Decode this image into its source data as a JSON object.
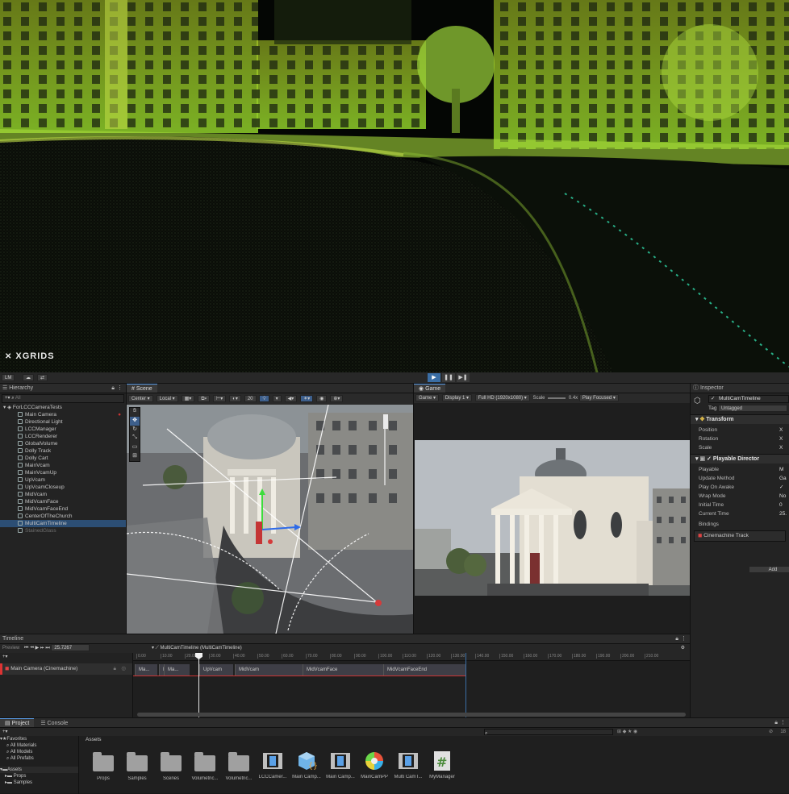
{
  "hero": {
    "brand": "XGRIDS"
  },
  "toolbar": {
    "account": "LM",
    "play_icon": "play-icon",
    "pause_icon": "pause-icon",
    "step_icon": "step-icon"
  },
  "hierarchy": {
    "title": "Hierarchy",
    "search": "All",
    "scene": "ForLCCCameraTests",
    "items": [
      {
        "label": "Main Camera",
        "state": "normal"
      },
      {
        "label": "Directional Light",
        "state": "normal"
      },
      {
        "label": "LCCManager",
        "state": "normal"
      },
      {
        "label": "LCCRenderer",
        "state": "normal"
      },
      {
        "label": "GlobalVolume",
        "state": "normal"
      },
      {
        "label": "Dolly Track",
        "state": "normal"
      },
      {
        "label": "Dolly Cart",
        "state": "normal"
      },
      {
        "label": "MainVcam",
        "state": "normal"
      },
      {
        "label": "MainVcamUp",
        "state": "normal"
      },
      {
        "label": "UpVcam",
        "state": "normal"
      },
      {
        "label": "UpVcamCloseup",
        "state": "normal"
      },
      {
        "label": "MidVcam",
        "state": "normal"
      },
      {
        "label": "MidVcamFace",
        "state": "normal"
      },
      {
        "label": "MidVcamFaceEnd",
        "state": "normal"
      },
      {
        "label": "CenterOfTheChurch",
        "state": "normal"
      },
      {
        "label": "MultiCamTimeline",
        "state": "selected"
      },
      {
        "label": "StainedGlass",
        "state": "dim"
      }
    ]
  },
  "scene": {
    "tab": "Scene",
    "pivot": "Center",
    "space": "Local",
    "grid_value": "20",
    "tools": [
      "hand",
      "move",
      "rotate",
      "scale",
      "rect",
      "transform"
    ]
  },
  "game": {
    "tab": "Game",
    "mode": "Game",
    "display": "Display 1",
    "resolution": "Full HD (1920x1080)",
    "scale_label": "Scale",
    "scale_value": "0.4x",
    "play_focused": "Play Focused"
  },
  "inspector": {
    "title": "Inspector",
    "object_name": "MultiCamTimeline",
    "tag_label": "Tag",
    "tag_value": "Untagged",
    "transform": {
      "header": "Transform",
      "rows": [
        {
          "label": "Position",
          "value": "X"
        },
        {
          "label": "Rotation",
          "value": "X"
        },
        {
          "label": "Scale",
          "value": "X"
        }
      ]
    },
    "director": {
      "header": "Playable Director",
      "rows": [
        {
          "label": "Playable",
          "value": "M"
        },
        {
          "label": "Update Method",
          "value": "Ga"
        },
        {
          "label": "Play On Awake",
          "value": "✓"
        },
        {
          "label": "Wrap Mode",
          "value": "No"
        },
        {
          "label": "Initial Time",
          "value": "0"
        },
        {
          "label": "Current Time",
          "value": "25."
        }
      ],
      "bindings_label": "Bindings",
      "binding_track": "Cinemachine Track"
    },
    "add_button": "Add"
  },
  "timeline": {
    "title": "Timeline",
    "preview": "Preview",
    "time": "25.7267",
    "asset": "MultiCamTimeline (MultiCamTimeline)",
    "ticks": [
      "0.00",
      "10.00",
      "20.00",
      "30.00",
      "40.00",
      "50.00",
      "60.00",
      "70.00",
      "80.00",
      "90.00",
      "100.00",
      "110.00",
      "120.00",
      "130.00",
      "140.00",
      "150.00",
      "160.00",
      "170.00",
      "180.00",
      "190.00",
      "200.00",
      "210.00"
    ],
    "track": "Main Camera (Cinemachine)",
    "clips": [
      {
        "label": "Ma..."
      },
      {
        "label": "Ma..."
      },
      {
        "label": "Ma..."
      },
      {
        "label": "UpVcam"
      },
      {
        "label": "MidVcam"
      },
      {
        "label": "MidVcamFace"
      },
      {
        "label": "MidVcamFaceEnd"
      }
    ]
  },
  "project": {
    "tabs": [
      "Project",
      "Console"
    ],
    "favorites": "Favorites",
    "fav_items": [
      "All Materials",
      "All Models",
      "All Prefabs"
    ],
    "assets_root": "Assets",
    "tree": [
      "Props",
      "Samples"
    ],
    "breadcrumb": "Assets",
    "assets": [
      {
        "label": "Props",
        "icon": "folder-icon"
      },
      {
        "label": "Samples",
        "icon": "folder-icon"
      },
      {
        "label": "Scenes",
        "icon": "folder-icon"
      },
      {
        "label": "Volumetric...",
        "icon": "folder-icon"
      },
      {
        "label": "Volumetric...",
        "icon": "folder-icon"
      },
      {
        "label": "LCCCamer...",
        "icon": "timeline-asset-icon"
      },
      {
        "label": "Main Camp...",
        "icon": "prefab-script-icon"
      },
      {
        "label": "Main Camp...",
        "icon": "timeline-asset-icon"
      },
      {
        "label": "MainCamPP",
        "icon": "post-process-icon"
      },
      {
        "label": "Multi CamT...",
        "icon": "timeline-asset-icon"
      },
      {
        "label": "MyManager",
        "icon": "csharp-script-icon"
      }
    ],
    "slider_value": "18"
  }
}
